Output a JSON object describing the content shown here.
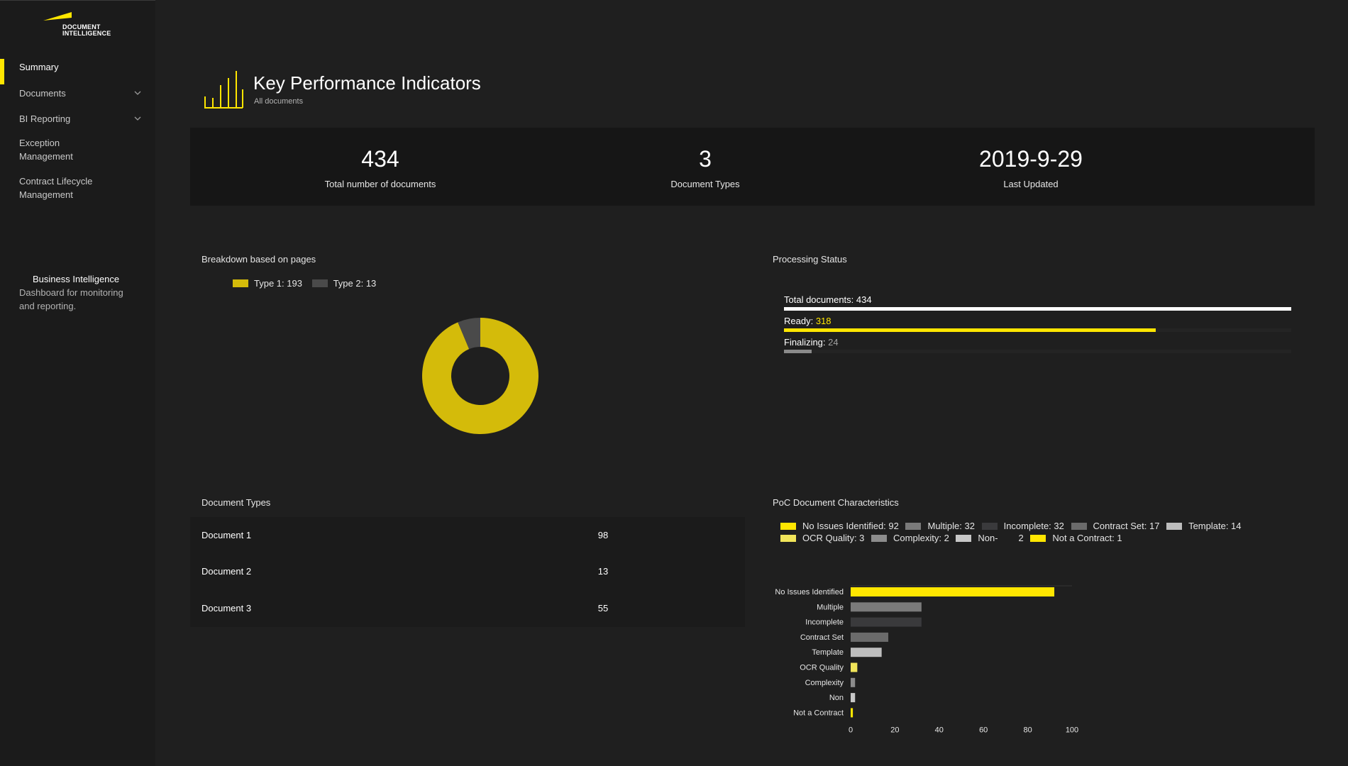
{
  "app": {
    "logo_line1": "DOCUMENT",
    "logo_line2": "INTELLIGENCE"
  },
  "sidebar": {
    "items": [
      {
        "label": "Summary"
      },
      {
        "label": "Documents"
      },
      {
        "label": "BI Reporting"
      },
      {
        "label": "Exception Management"
      },
      {
        "label": "Contract Lifecycle Management"
      }
    ],
    "bi_title": "Business Intelligence",
    "bi_description": "Dashboard for monitoring and reporting."
  },
  "header": {
    "title": "Key Performance Indicators",
    "subtitle": "All documents"
  },
  "stats": [
    {
      "value": "434",
      "label": "Total number of documents"
    },
    {
      "value": "3",
      "label": "Document Types"
    },
    {
      "value": "2019-9-29",
      "label": "Last Updated"
    }
  ],
  "breakdown": {
    "title": "Breakdown based on pages",
    "legend": [
      "Type 1: 193",
      "Type 2: 13"
    ]
  },
  "processing": {
    "title": "Processing Status",
    "total_label": "Total documents: 434",
    "ready_label": "Ready: ",
    "ready_value": "318",
    "finalizing_label": "Finalizing: ",
    "finalizing_value": "24"
  },
  "document_types": {
    "title": "Document Types",
    "rows": [
      {
        "name": "Document 1",
        "value": "98"
      },
      {
        "name": "Document 2",
        "value": "13"
      },
      {
        "name": "Document 3",
        "value": "55"
      }
    ]
  },
  "poc": {
    "title": "PoC Document Characteristics",
    "legend": [
      "No Issues Identified: 92",
      "Multiple: 32",
      "Incomplete: 32",
      "Contract Set: 17",
      "Template: 14",
      "OCR Quality: 3",
      "Complexity: 2",
      "Non-        2",
      "Not a Contract: 1"
    ]
  },
  "colors": {
    "accent": "#ffe600",
    "donut_type1": "#d4bb0a",
    "donut_type2": "#4a4a4a"
  },
  "chart_data": [
    {
      "type": "pie",
      "categories": [
        "Type 1",
        "Type 2"
      ],
      "values": [
        193,
        13
      ],
      "colors": [
        "#d4bb0a",
        "#4a4a4a"
      ],
      "donut": true,
      "legend": "top-left"
    },
    {
      "type": "bar",
      "orientation": "horizontal",
      "categories": [
        "No Issues Identified",
        "Multiple",
        "Incomplete",
        "Contract Set",
        "Template",
        "OCR Quality",
        "Complexity",
        "Non",
        "Not a Contract"
      ],
      "values": [
        92,
        32,
        32,
        17,
        14,
        3,
        2,
        2,
        1
      ],
      "colors": [
        "#ffe600",
        "#7a7a7a",
        "#3a3a3c",
        "#6b6b6b",
        "#bdbdbd",
        "#f1e55a",
        "#8c8c8c",
        "#c8c8c8",
        "#ffe600"
      ],
      "xticks": [
        "0",
        "20",
        "40",
        "60",
        "80",
        "100"
      ],
      "xlim": [
        0,
        100
      ],
      "grid": false
    }
  ]
}
